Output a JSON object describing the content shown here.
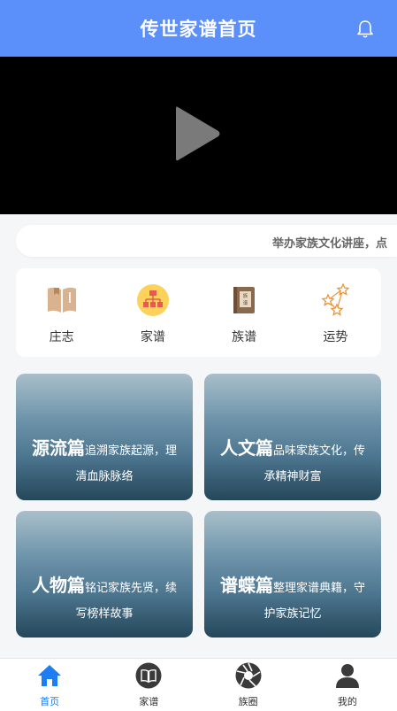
{
  "header": {
    "title": "传世家谱首页"
  },
  "notice": {
    "text": "举办家族文化讲座，点"
  },
  "quick_links": [
    {
      "label": "庄志",
      "icon": "book-icon"
    },
    {
      "label": "家谱",
      "icon": "family-tree-icon"
    },
    {
      "label": "族谱",
      "icon": "genealogy-book-icon"
    },
    {
      "label": "运势",
      "icon": "stars-icon"
    }
  ],
  "cards": [
    {
      "title": "源流篇",
      "desc": "追溯家族起源，理清血脉脉络"
    },
    {
      "title": "人文篇",
      "desc": "品味家族文化，传承精神财富"
    },
    {
      "title": "人物篇",
      "desc": "铭记家族先贤，续写榜样故事"
    },
    {
      "title": "谱蝶篇",
      "desc": "整理家谱典籍，守护家族记忆"
    }
  ],
  "tabs": [
    {
      "label": "首页",
      "icon": "home-icon"
    },
    {
      "label": "家谱",
      "icon": "book-circle-icon"
    },
    {
      "label": "族圈",
      "icon": "aperture-icon"
    },
    {
      "label": "我的",
      "icon": "user-icon"
    }
  ],
  "colors": {
    "header": "#5b8ff9",
    "tab_active": "#1e7df0"
  }
}
